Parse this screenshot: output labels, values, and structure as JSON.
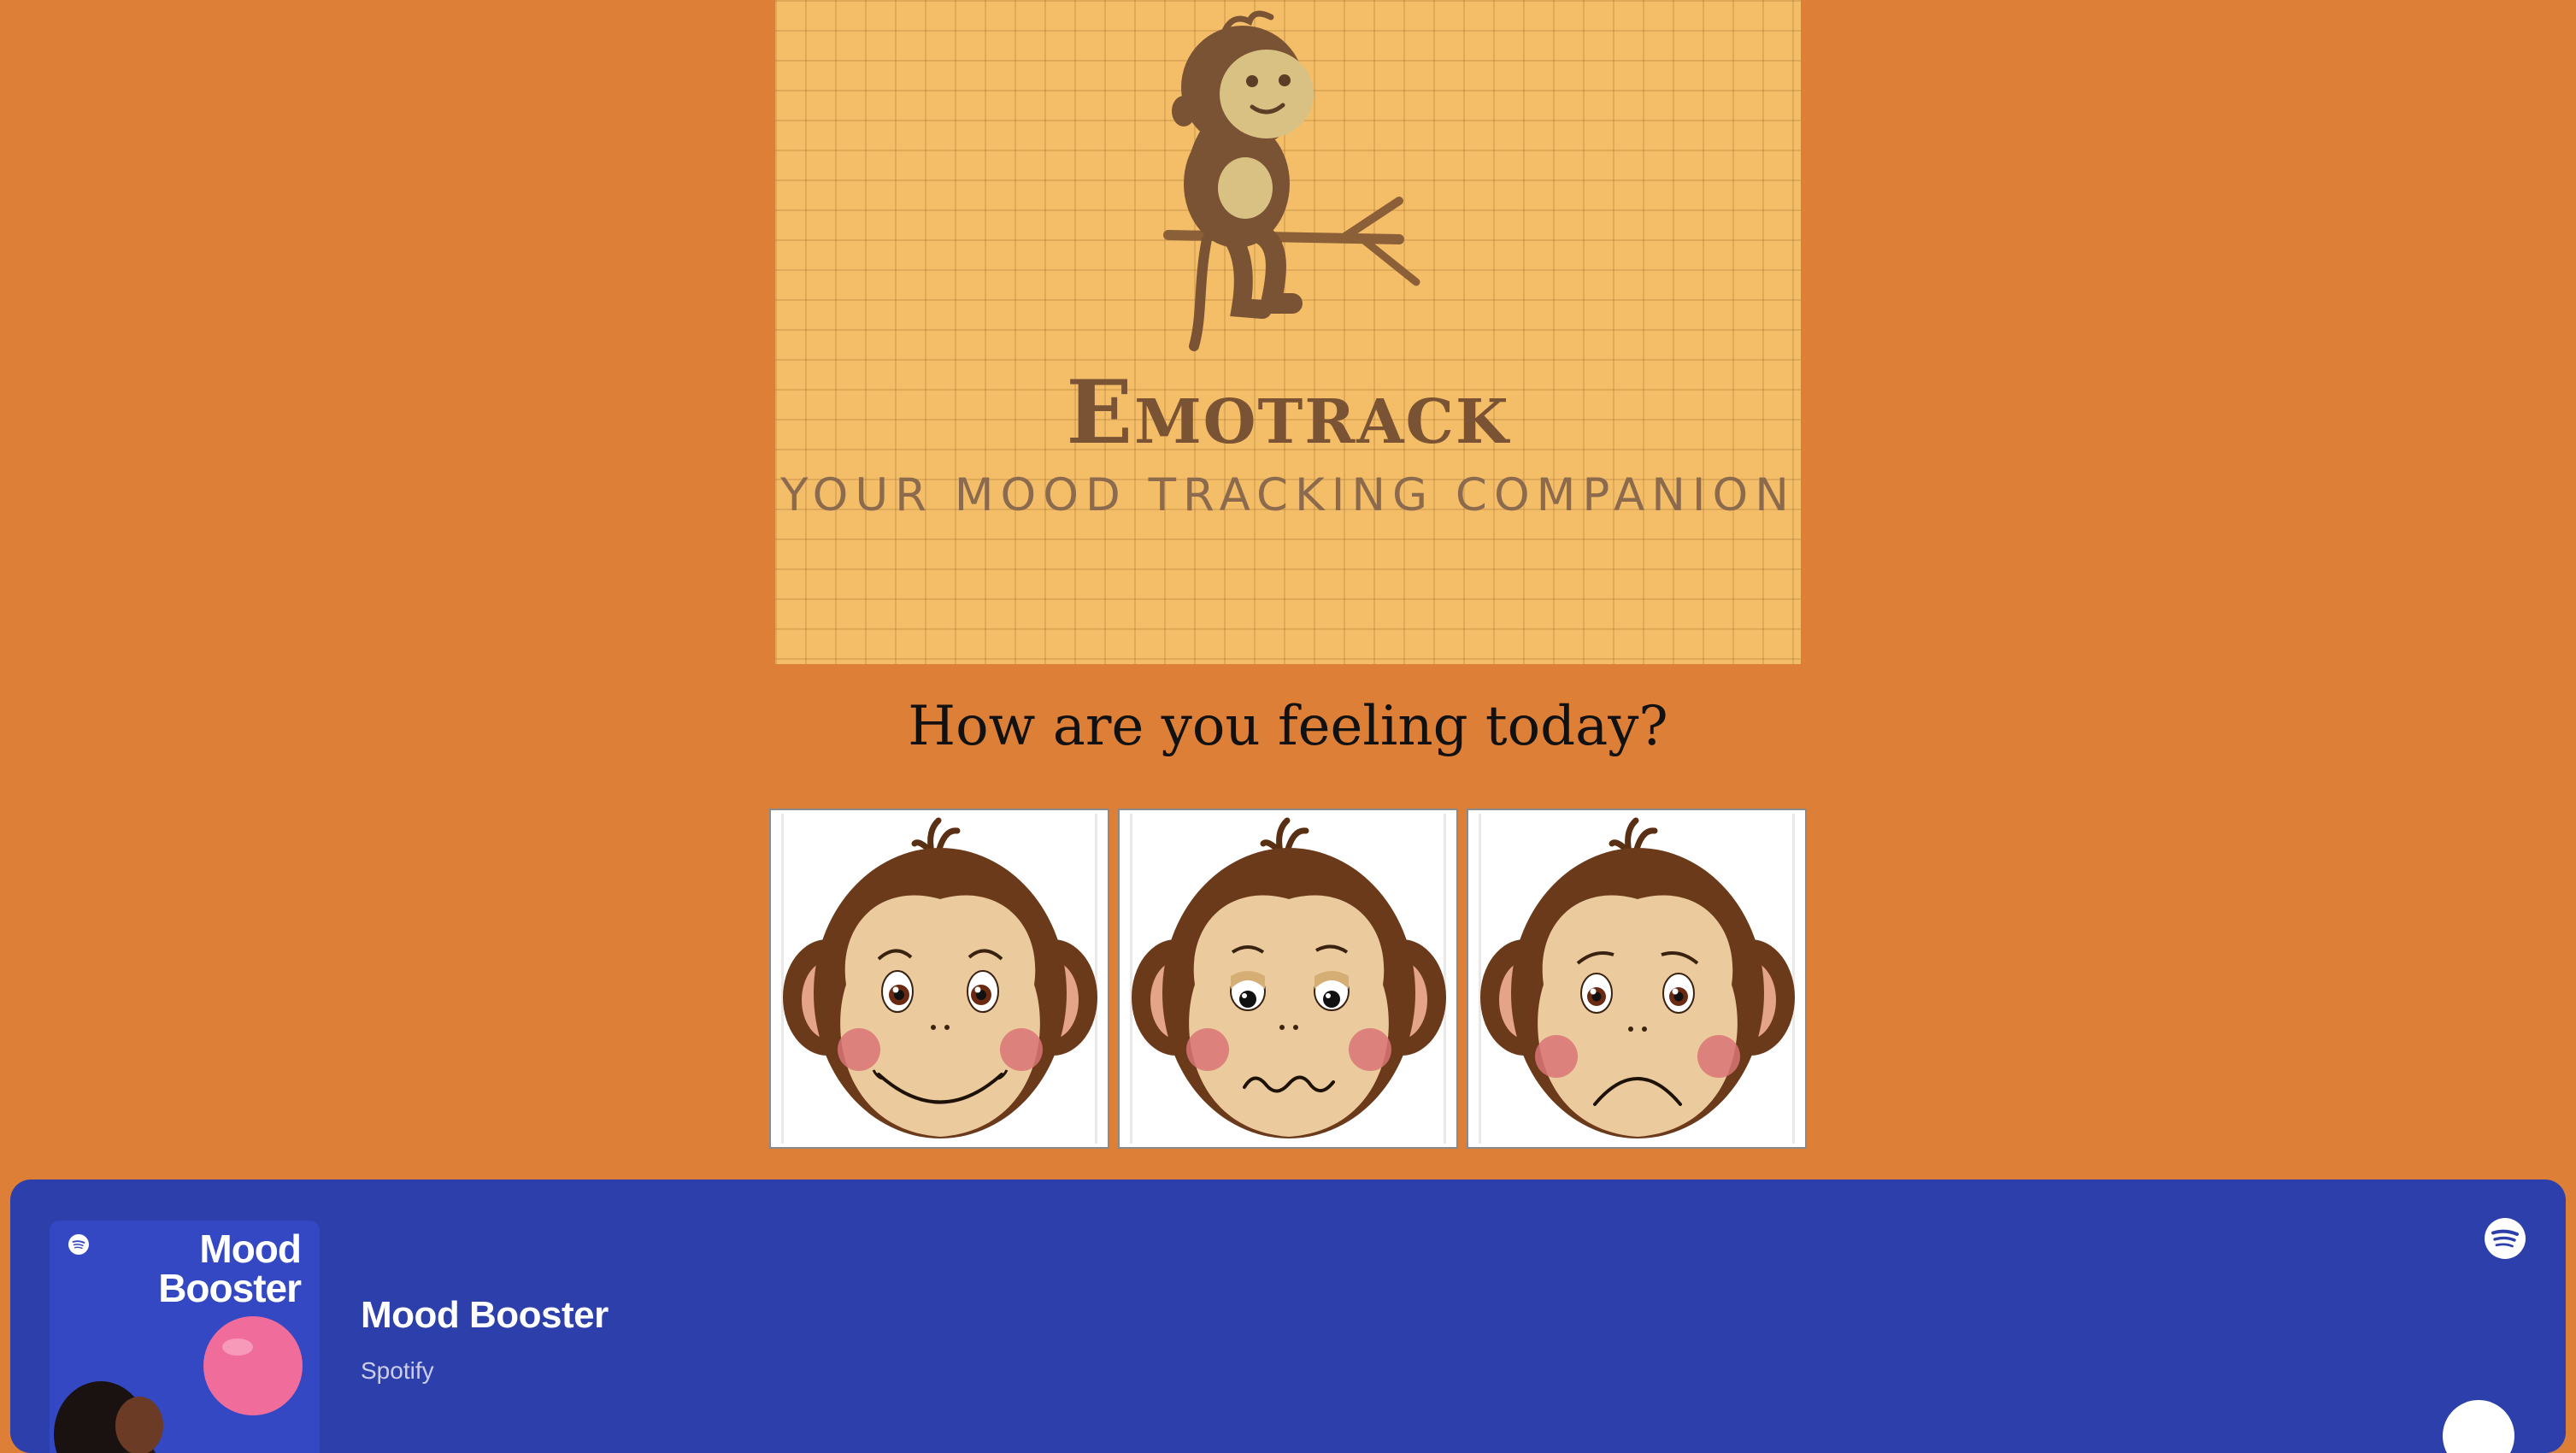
{
  "logo": {
    "title": "Emotrack",
    "subtitle": "YOUR MOOD TRACKING COMPANION"
  },
  "question": "How are you feeling today?",
  "moods": [
    {
      "name": "happy",
      "icon": "happy-monkey-icon"
    },
    {
      "name": "meh",
      "icon": "meh-monkey-icon"
    },
    {
      "name": "sad",
      "icon": "sad-monkey-icon"
    }
  ],
  "spotify_embed": {
    "cover_title": "Mood Booster",
    "playlist_title": "Mood Booster",
    "playlist_owner": "Spotify",
    "logo_icon": "spotify-icon",
    "play_icon": "play-button-icon"
  },
  "colors": {
    "page_background": "#DD7F36",
    "logo_background": "#F4BE68",
    "logo_text": "#7A5335",
    "embed_background": "#2D3FAB"
  }
}
